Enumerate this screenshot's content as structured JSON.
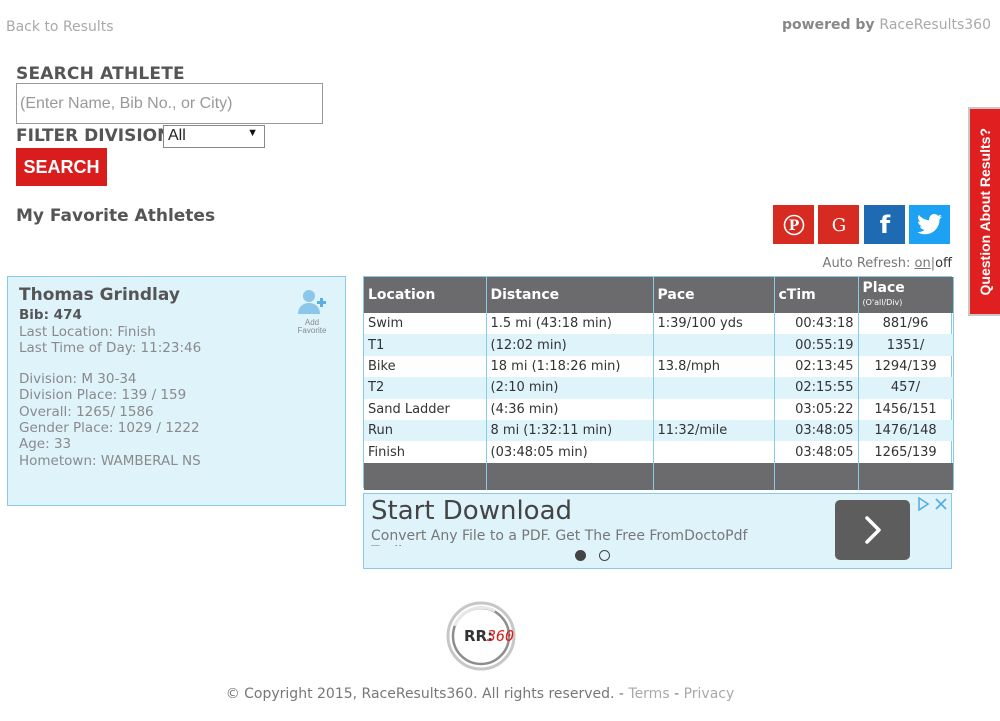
{
  "header": {
    "back_link": "Back to Results",
    "powered_prefix": "powered by",
    "powered_brand": "RaceResults360"
  },
  "search": {
    "label": "SEARCH ATHLETE",
    "placeholder": "(Enter Name, Bib No., or City)",
    "filter_label": "FILTER DIVISION",
    "filter_value": "All",
    "button_label": "SEARCH"
  },
  "favorites": {
    "heading": "My Favorite Athletes"
  },
  "social": {
    "pinterest_glyph": "P",
    "google_glyph": "G",
    "facebook_glyph": "f"
  },
  "side_tab": {
    "label": "Question About Results?"
  },
  "auto_refresh": {
    "label": "Auto Refresh:",
    "on": "on",
    "separator": "|",
    "off": "off"
  },
  "athlete": {
    "name": "Thomas Grindlay",
    "bib": "Bib: 474",
    "last_location": "Last Location: Finish",
    "last_time_of_day": "Last Time of Day: 11:23:46",
    "division": "Division: M 30-34",
    "division_place": "Division Place: 139 / 159",
    "overall": "Overall: 1265/ 1586",
    "gender_place": "Gender Place: 1029 / 1222",
    "age": "Age: 33",
    "hometown": "Hometown: WAMBERAL NS",
    "add_favorite_line1": "Add",
    "add_favorite_line2": "Favorite"
  },
  "splits": {
    "headers": {
      "location": "Location",
      "distance": "Distance",
      "pace": "Pace",
      "ctim": "cTim",
      "place": "Place",
      "place_sub": "(O'all/Div)"
    },
    "rows": [
      {
        "location": "Swim",
        "distance": "1.5 mi (43:18 min)",
        "pace": "1:39/100 yds",
        "ctim": "00:43:18",
        "place": "881/96"
      },
      {
        "location": "T1",
        "distance": "(12:02 min)",
        "pace": "",
        "ctim": "00:55:19",
        "place": "1351/"
      },
      {
        "location": "Bike",
        "distance": "18 mi (1:18:26 min)",
        "pace": "13.8/mph",
        "ctim": "02:13:45",
        "place": "1294/139"
      },
      {
        "location": "T2",
        "distance": "(2:10 min)",
        "pace": "",
        "ctim": "02:15:55",
        "place": "457/"
      },
      {
        "location": "Sand Ladder",
        "distance": "(4:36 min)",
        "pace": "",
        "ctim": "03:05:22",
        "place": "1456/151"
      },
      {
        "location": "Run",
        "distance": "8 mi (1:32:11 min)",
        "pace": "11:32/mile",
        "ctim": "03:48:05",
        "place": "1476/148"
      },
      {
        "location": "Finish",
        "distance": "(03:48:05 min)",
        "pace": "",
        "ctim": "03:48:05",
        "place": "1265/139"
      }
    ]
  },
  "ad": {
    "title": "Start Download",
    "text": "Convert Any File to a PDF. Get The Free FromDoctoPdf Toolbar",
    "arrow": "›"
  },
  "footer": {
    "logo_text_a": "RR:",
    "logo_text_b": "360",
    "copyright": "© Copyright 2015, RaceResults360. All rights reserved.",
    "sep1": " - ",
    "terms": "Terms",
    "sep2": " - ",
    "privacy": "Privacy"
  },
  "colors": {
    "accent_red": "#d91c1c",
    "panel_blue": "#dff3fb",
    "border_blue": "#87cce6",
    "header_gray": "#6b6b6d",
    "facebook": "#1e6ab3",
    "twitter": "#1da1f2"
  }
}
